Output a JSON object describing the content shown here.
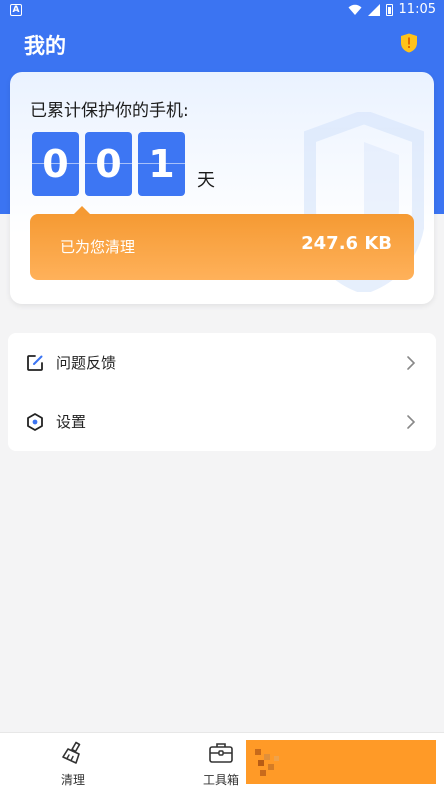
{
  "status_bar": {
    "app_badge": "A",
    "time": "11:05"
  },
  "header": {
    "title": "我的"
  },
  "protection_card": {
    "heading": "已累计保护你的手机:",
    "days_digits": [
      "0",
      "0",
      "1"
    ],
    "days_unit": "天",
    "cleaned_label": "已为您清理",
    "cleaned_value": "247.6 KB"
  },
  "menu": {
    "items": [
      {
        "label": "问题反馈",
        "icon": "edit-icon"
      },
      {
        "label": "设置",
        "icon": "settings-hexagon-icon"
      }
    ]
  },
  "bottom_nav": {
    "items": [
      {
        "label": "清理",
        "icon": "broom-icon"
      },
      {
        "label": "工具箱",
        "icon": "toolbox-icon"
      }
    ]
  },
  "colors": {
    "primary_blue": "#3b74f2",
    "accent_orange": "#f59a33",
    "badge_yellow": "#ffc21a"
  }
}
